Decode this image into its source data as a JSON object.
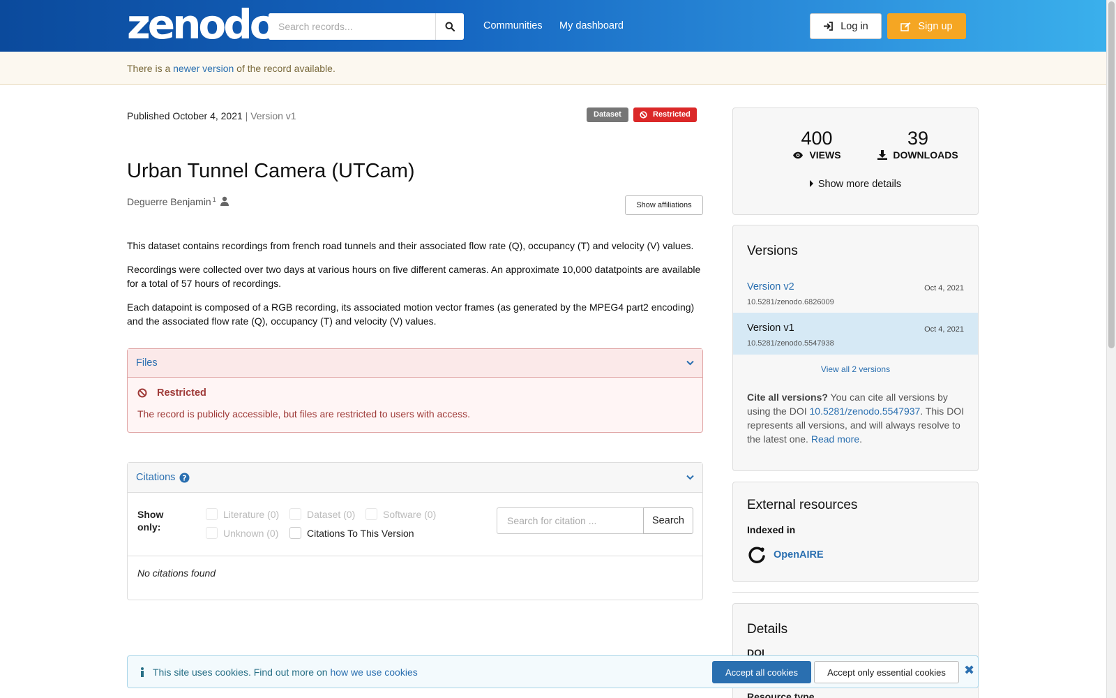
{
  "header": {
    "logo": "zenodo",
    "search_placeholder": "Search records...",
    "nav": [
      "Communities",
      "My dashboard"
    ],
    "login_label": "Log in",
    "signup_label": "Sign up"
  },
  "banner": {
    "prefix": "There is a ",
    "link": "newer version",
    "suffix": " of the record available."
  },
  "record": {
    "published": "Published October 4, 2021",
    "version": "| Version v1",
    "badge_type": "Dataset",
    "badge_access": "Restricted",
    "title": "Urban Tunnel Camera (UTCam)",
    "author": "Deguerre Benjamin",
    "author_sup": "1",
    "show_affiliations": "Show affiliations",
    "description": [
      "This dataset contains recordings from french road tunnels and their associated flow rate (Q), occupancy (T) and velocity (V) values.",
      "Recordings were collected over two days at various hours on five different cameras. An approximate 10,000 datatpoints are available for a total of 57 hours of recordings.",
      "Each datapoint is composed of a RGB recording, its associated motion vector frames (as generated by the MPEG4 part2 encoding) and the associated flow rate (Q), occupancy (T) and velocity (V) values."
    ]
  },
  "files": {
    "header": "Files",
    "restricted_title": "Restricted",
    "restricted_msg": "The record is publicly accessible, but files are restricted to users with access."
  },
  "citations": {
    "header": "Citations",
    "show_only": "Show only:",
    "filters": [
      "Literature (0)",
      "Dataset (0)",
      "Software (0)",
      "Unknown (0)",
      "Citations To This Version"
    ],
    "search_placeholder": "Search for citation ...",
    "search_button": "Search",
    "empty": "No citations found"
  },
  "stats": {
    "views": "400",
    "views_label": "VIEWS",
    "downloads": "39",
    "downloads_label": "DOWNLOADS",
    "more": "Show more details"
  },
  "versions": {
    "title": "Versions",
    "items": [
      {
        "name": "Version v2",
        "date": "Oct 4, 2021",
        "doi": "10.5281/zenodo.6826009"
      },
      {
        "name": "Version v1",
        "date": "Oct 4, 2021",
        "doi": "10.5281/zenodo.5547938"
      }
    ],
    "view_all": "View all 2 versions",
    "cite_bold": "Cite all versions?",
    "cite_text1": " You can cite all versions by using the DOI ",
    "cite_doi": "10.5281/zenodo.5547937",
    "cite_text2": ". This DOI represents all versions, and will always resolve to the latest one. ",
    "read_more": "Read more",
    "cite_end": "."
  },
  "external": {
    "title": "External resources",
    "indexed_in": "Indexed in",
    "openaire": "OpenAIRE"
  },
  "details": {
    "title": "Details",
    "doi_label": "DOI",
    "resource_type_label": "Resource type"
  },
  "cookie": {
    "text": "This site uses cookies. Find out more on ",
    "link": "how we use cookies",
    "accept_all": "Accept all cookies",
    "accept_essential": "Accept only essential cookies"
  },
  "colors": {
    "header_start": "#0b4a9c",
    "header_end": "#3ab0ec",
    "signup": "#f5a623",
    "restricted": "#db2828",
    "link": "#2a6fb0"
  }
}
